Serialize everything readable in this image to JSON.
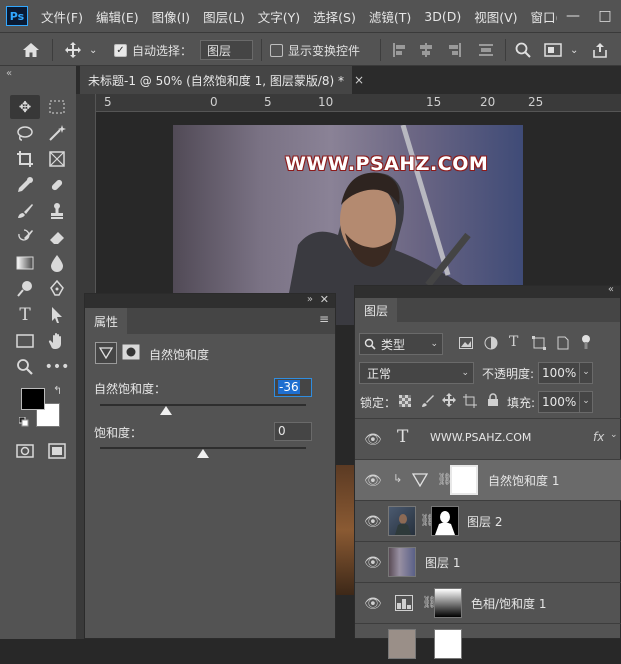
{
  "app": {
    "logo": "Ps"
  },
  "menu": [
    "文件(F)",
    "编辑(E)",
    "图像(I)",
    "图层(L)",
    "文字(Y)",
    "选择(S)",
    "滤镜(T)",
    "3D(D)",
    "视图(V)",
    "窗口("
  ],
  "window_controls": [
    "—",
    "□"
  ],
  "options": {
    "auto_select_label": "自动选择：",
    "auto_select_target": "图层",
    "show_transform_label": "显示变换控件"
  },
  "document_tab": {
    "title": "未标题-1 @ 50% (自然饱和度 1, 图层蒙版/8) *",
    "close": "×"
  },
  "ruler": {
    "marks": [
      "5",
      "0",
      "5",
      "10",
      "15",
      "20",
      "25"
    ]
  },
  "canvas": {
    "watermark": "WWW.PSAHZ.COM"
  },
  "properties": {
    "tab": "属性",
    "adjustment_title": "自然饱和度",
    "vibrance_label": "自然饱和度：",
    "vibrance_value": "-36",
    "vibrance_level": -36,
    "saturation_label": "饱和度：",
    "saturation_value": "0",
    "saturation_level": 0
  },
  "layers": {
    "tab": "图层",
    "filter_label": "类型",
    "blend_mode": "正常",
    "opacity_label": "不透明度:",
    "opacity_value": "100%",
    "lock_label": "锁定：",
    "fill_label": "填充:",
    "fill_value": "100%",
    "rows": [
      {
        "name": "WWW.PSAHZ.COM",
        "fx": "fx"
      },
      {
        "name": "自然饱和度 1"
      },
      {
        "name": "图层 2"
      },
      {
        "name": "图层 1"
      },
      {
        "name": "色相/饱和度 1"
      }
    ]
  },
  "colors": {
    "accent": "#31a8ff",
    "panel": "#535353",
    "canvas_bg": "#282828",
    "watermark_stroke": "#8c1b1b"
  }
}
